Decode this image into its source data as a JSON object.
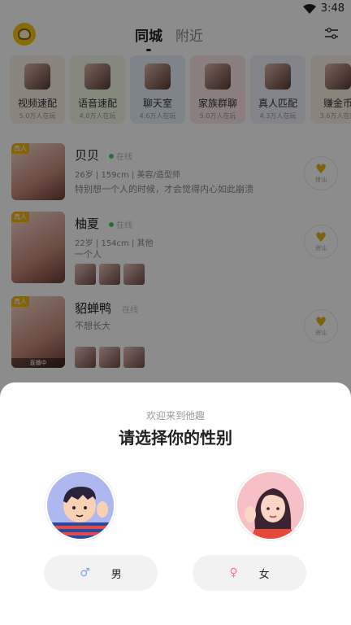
{
  "status": {
    "time": "3:48"
  },
  "header": {
    "tabs": [
      "同城",
      "附近"
    ],
    "active_tab": 0
  },
  "categories": [
    {
      "name": "视频速配",
      "count": "5.0万人在玩",
      "bg": "#fcf2e2"
    },
    {
      "name": "语音速配",
      "count": "4.0万人在玩",
      "bg": "#f0f8e4"
    },
    {
      "name": "聊天室",
      "count": "4.6万人在玩",
      "bg": "#e8f1fb"
    },
    {
      "name": "家族群聊",
      "count": "5.0万人在玩",
      "bg": "#fde6e6"
    },
    {
      "name": "真人匹配",
      "count": "4.3万人在玩",
      "bg": "#eef0fc"
    },
    {
      "name": "赚金币",
      "count": "3.6万人在玩",
      "bg": "#fcf2e2"
    }
  ],
  "users": [
    {
      "name": "贝贝",
      "online": "在线",
      "meta": "26岁 | 159cm | 美容/造型师",
      "bio": "特别想一个人的时候，才会觉得内心如此崩溃",
      "badge": "真人",
      "live": "",
      "photos": 0,
      "greet": "搭讪"
    },
    {
      "name": "柚夏",
      "online": "在线",
      "meta": "22岁 | 154cm | 其他",
      "bio": "一个人",
      "badge": "真人",
      "live": "",
      "photos": 3,
      "greet": "搭讪"
    },
    {
      "name": "貂蝉鸭",
      "online": "在线",
      "meta": "",
      "bio": "不想长大",
      "badge": "真人",
      "live": "直播中",
      "photos": 3,
      "greet": "搭讪"
    }
  ],
  "gender_sheet": {
    "welcome": "欢迎来到他趣",
    "title": "请选择你的性别",
    "male_label": "男",
    "female_label": "女",
    "male_icon": "male-symbol-icon",
    "female_icon": "female-symbol-icon"
  }
}
